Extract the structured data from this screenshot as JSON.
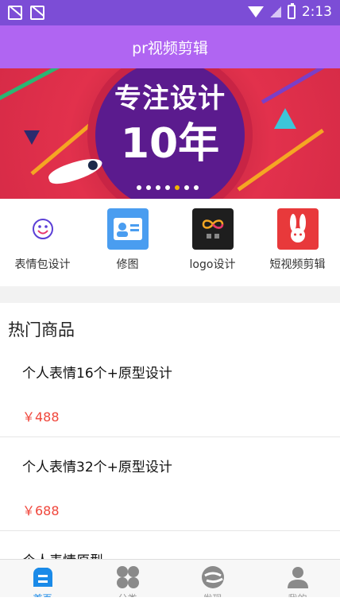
{
  "status_bar": {
    "time": "2:13"
  },
  "title_bar": {
    "title": "pr视频剪辑"
  },
  "banner": {
    "headline": "专注设计",
    "big_text": "10年",
    "slide_count": 7,
    "active_slide": 5
  },
  "quick_menu": [
    {
      "label": "表情包设计",
      "icon": "smiley-icon"
    },
    {
      "label": "修图",
      "icon": "id-card-icon"
    },
    {
      "label": "logo设计",
      "icon": "logo-icon"
    },
    {
      "label": "短视频剪辑",
      "icon": "rabbit-icon"
    }
  ],
  "hot_section": {
    "title": "热门商品",
    "items": [
      {
        "name": "个人表情16个+原型设计",
        "price": "￥488"
      },
      {
        "name": "个人表情32个+原型设计",
        "price": "￥688"
      },
      {
        "name": "个人表情原型",
        "price": ""
      }
    ]
  },
  "tabbar": [
    {
      "label": "首页",
      "icon": "home-icon",
      "active": true
    },
    {
      "label": "分类",
      "icon": "category-icon",
      "active": false
    },
    {
      "label": "发现",
      "icon": "discover-icon",
      "active": false
    },
    {
      "label": "我的",
      "icon": "profile-icon",
      "active": false
    }
  ],
  "colors": {
    "status_bar": "#7c4dd6",
    "title_bar": "#b065f2",
    "price": "#f0463b",
    "tab_active": "#1a8ae8"
  }
}
